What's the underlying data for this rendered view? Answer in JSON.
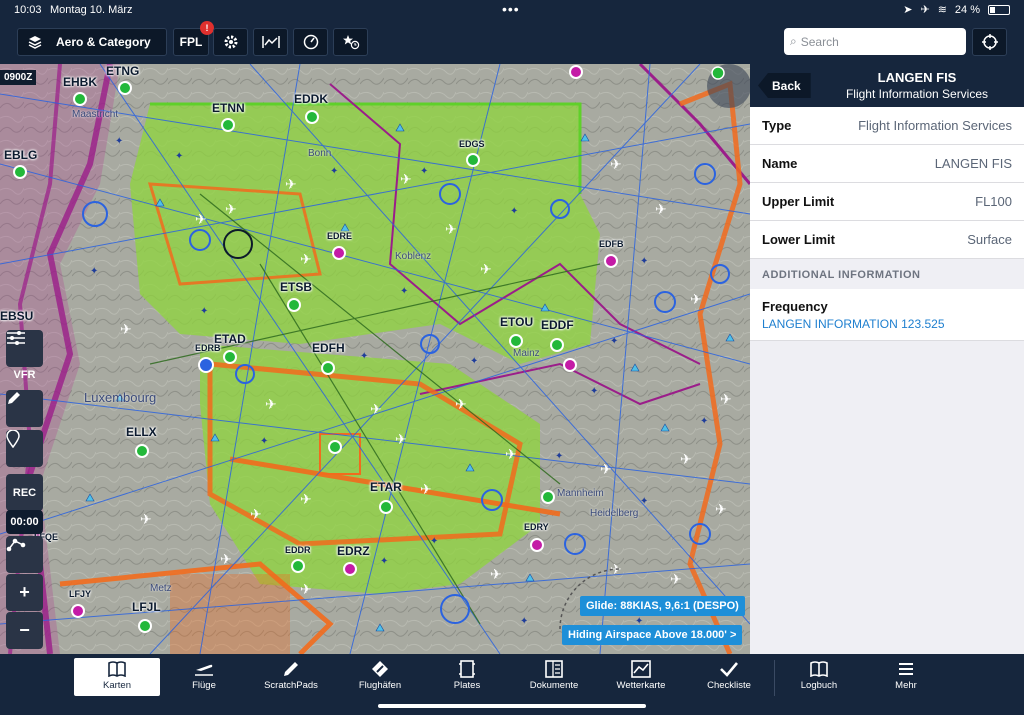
{
  "status": {
    "time": "10:03",
    "date": "Montag 10. März",
    "battery": "24 %"
  },
  "toolbar": {
    "layer_label": "Aero & Category",
    "fpl_label": "FPL",
    "fpl_badge": "!",
    "search_placeholder": "Search"
  },
  "map": {
    "timestamp": "0900Z",
    "labels": [
      "EHBK",
      "ETNG",
      "EBLG",
      "ETNN",
      "EDDK",
      "EDGS",
      "EDRE",
      "EDFB",
      "ETSB",
      "EBSU",
      "ETOU",
      "EDDF",
      "ETAD",
      "EDRB",
      "EDFH",
      "ELLX",
      "ETAR",
      "EDRY",
      "LFQE",
      "EDDR",
      "EDRZ",
      "LFJY",
      "LFJL"
    ],
    "cities": [
      "Maastricht",
      "Bonn",
      "Koblenz",
      "Mainz",
      "Luxembourg",
      "Mannheim",
      "Heidelberg",
      "Metz"
    ],
    "tools": {
      "vfr": "VFR",
      "rec": "REC",
      "timer": "00:00"
    },
    "glide": "Glide: 88KIAS, 9,6:1 (DESPO)",
    "hiding": "Hiding Airspace Above 18.000' >"
  },
  "panel": {
    "back_label": "Back",
    "title": "LANGEN FIS",
    "subtitle": "Flight Information Services",
    "rows": [
      {
        "key": "Type",
        "value": "Flight Information Services"
      },
      {
        "key": "Name",
        "value": "LANGEN FIS"
      },
      {
        "key": "Upper Limit",
        "value": "FL100"
      },
      {
        "key": "Lower Limit",
        "value": "Surface"
      }
    ],
    "section_header": "ADDITIONAL INFORMATION",
    "frequency_label": "Frequency",
    "frequency_value": "LANGEN INFORMATION 123.525"
  },
  "tabs": [
    "Karten",
    "Flüge",
    "ScratchPads",
    "Flughäfen",
    "Plates",
    "Dokumente",
    "Wetterkarte",
    "Checkliste",
    "Logbuch",
    "Mehr"
  ],
  "colors": {
    "chrome": "#16263d",
    "accent": "#1e8fd8",
    "airspace_green": "#8fd63c",
    "airway_blue": "#2b63e0",
    "restricted_magenta": "#9b1d8a",
    "mil_orange": "#f26b1d"
  }
}
